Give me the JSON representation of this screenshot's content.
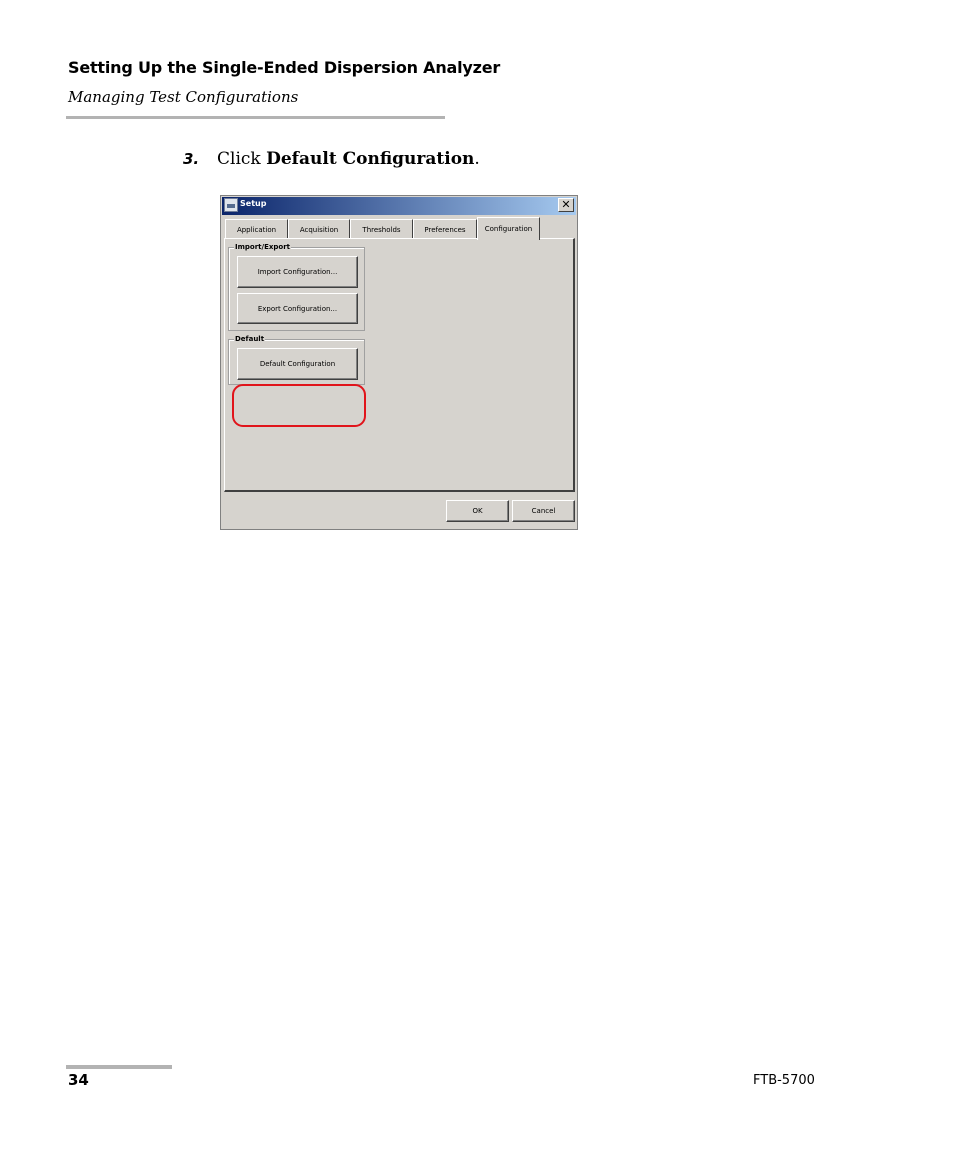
{
  "header": {
    "title": "Setting Up the Single-Ended Dispersion Analyzer",
    "subtitle": "Managing Test Configurations"
  },
  "step": {
    "number": "3.",
    "text_before": "Click ",
    "bold_text": "Default Configuration",
    "text_after": "."
  },
  "dialog": {
    "title": "Setup",
    "close_glyph": "✕",
    "tabs": [
      {
        "label": "Application"
      },
      {
        "label": "Acquisition"
      },
      {
        "label": "Thresholds"
      },
      {
        "label": "Preferences"
      },
      {
        "label": "Configuration"
      }
    ],
    "active_tab": "Configuration",
    "import_export": {
      "label": "Import/Export",
      "import_button": "Import Configuration...",
      "export_button": "Export Configuration..."
    },
    "default": {
      "label": "Default",
      "default_button": "Default Configuration"
    },
    "ok_button": "OK",
    "cancel_button": "Cancel",
    "highlight_color": "#e1141b"
  },
  "footer": {
    "page_number": "34",
    "product": "FTB-5700"
  }
}
